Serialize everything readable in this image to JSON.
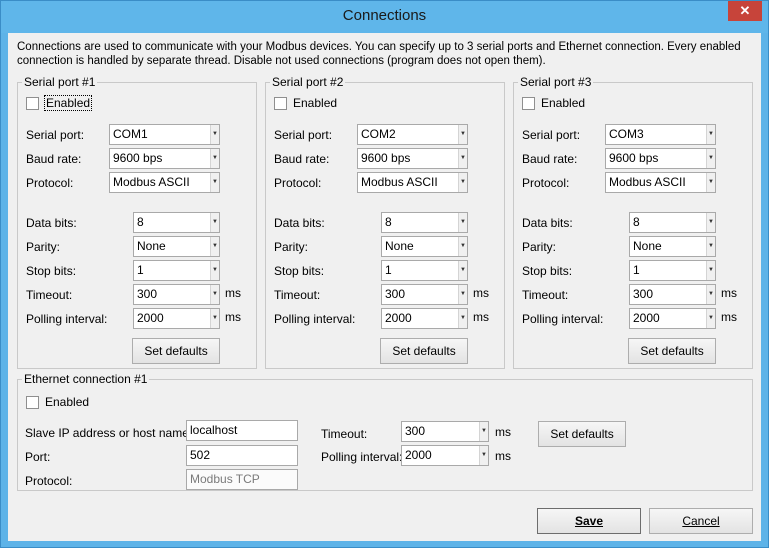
{
  "window": {
    "title": "Connections",
    "close_glyph": "✕"
  },
  "description": "Connections are used to communicate with your Modbus devices. You can specify up to 3 serial ports and Ethernet connection. Every enabled connection is handled by separate thread. Disable not used connections (program does not open them).",
  "serial_labels": {
    "enabled": "Enabled",
    "serial_port": "Serial port:",
    "baud_rate": "Baud rate:",
    "protocol": "Protocol:",
    "data_bits": "Data bits:",
    "parity": "Parity:",
    "stop_bits": "Stop bits:",
    "timeout": "Timeout:",
    "polling_interval": "Polling interval:",
    "ms": "ms",
    "set_defaults": "Set defaults"
  },
  "serial_ports": [
    {
      "title": "Serial port #1",
      "enabled": false,
      "port": "COM1",
      "baud": "9600 bps",
      "protocol": "Modbus ASCII",
      "data_bits": "8",
      "parity": "None",
      "stop_bits": "1",
      "timeout": "300",
      "polling": "2000"
    },
    {
      "title": "Serial port #2",
      "enabled": false,
      "port": "COM2",
      "baud": "9600 bps",
      "protocol": "Modbus ASCII",
      "data_bits": "8",
      "parity": "None",
      "stop_bits": "1",
      "timeout": "300",
      "polling": "2000"
    },
    {
      "title": "Serial port #3",
      "enabled": false,
      "port": "COM3",
      "baud": "9600 bps",
      "protocol": "Modbus ASCII",
      "data_bits": "8",
      "parity": "None",
      "stop_bits": "1",
      "timeout": "300",
      "polling": "2000"
    }
  ],
  "ethernet": {
    "title": "Ethernet connection #1",
    "enabled_label": "Enabled",
    "enabled": false,
    "ip_label": "Slave IP address or host name:",
    "ip_value": "localhost",
    "port_label": "Port:",
    "port_value": "502",
    "protocol_label": "Protocol:",
    "protocol_value": "Modbus TCP",
    "timeout_label": "Timeout:",
    "timeout_value": "300",
    "polling_label": "Polling interval:",
    "polling_value": "2000",
    "ms": "ms",
    "set_defaults": "Set defaults"
  },
  "footer": {
    "save_label": "Save",
    "cancel_label": "Cancel"
  },
  "colors": {
    "titlebar": "#5fb6ea",
    "close": "#c7443a",
    "client": "#f0f0f0"
  }
}
